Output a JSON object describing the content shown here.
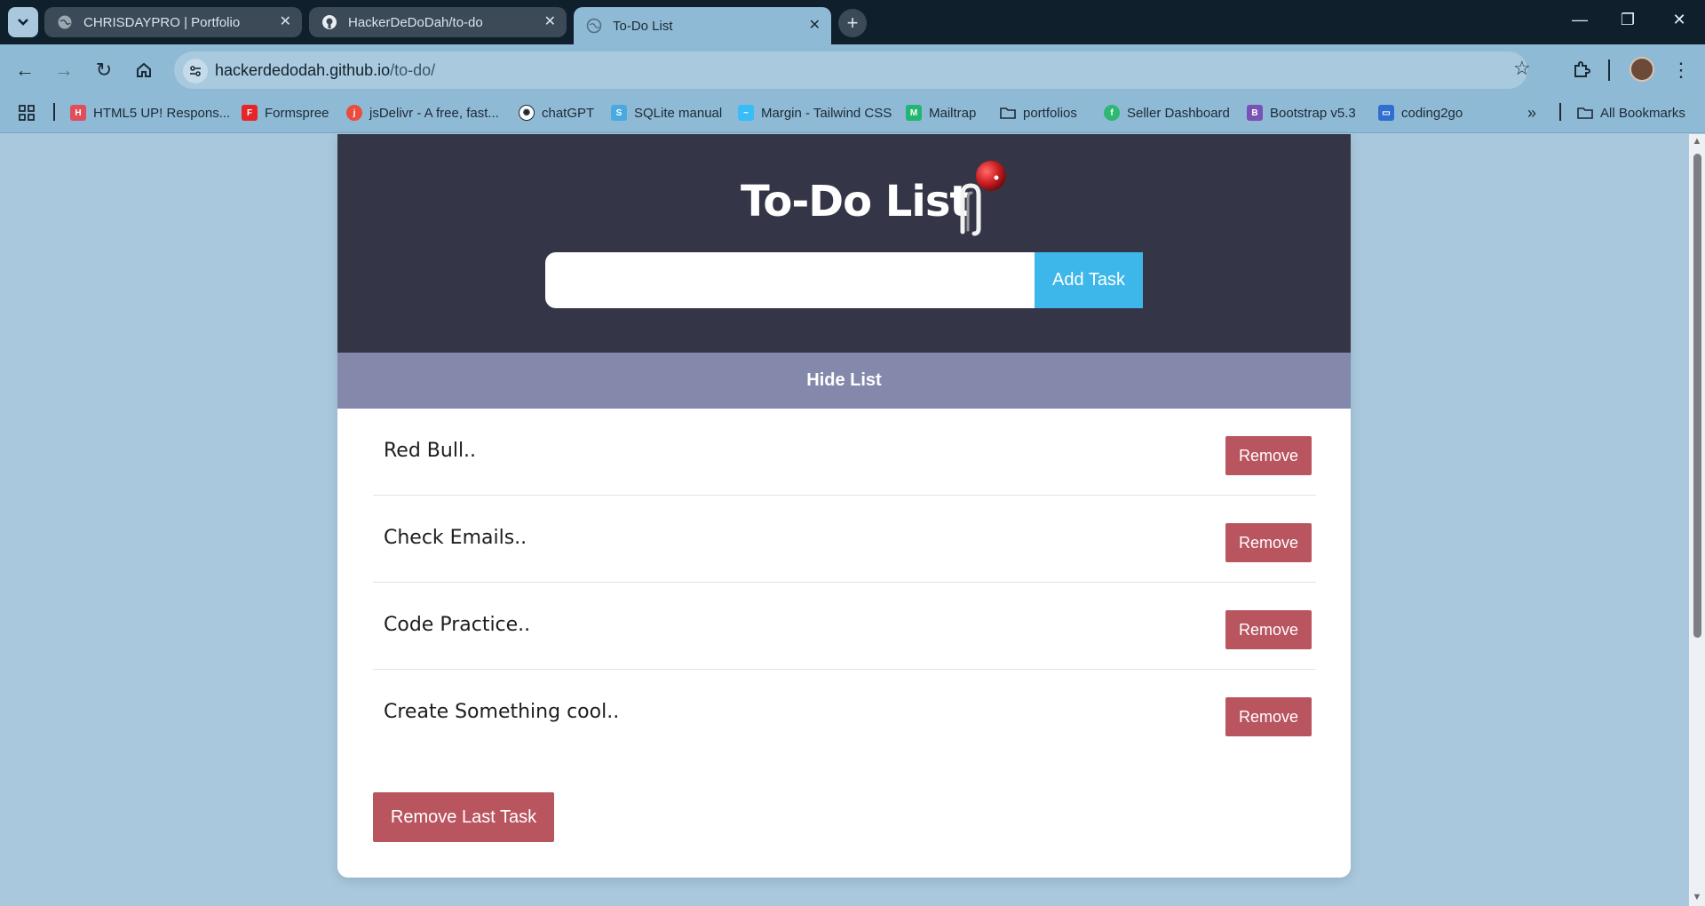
{
  "browser": {
    "tabs": [
      {
        "title": "CHRISDAYPRO | Portfolio",
        "icon": "globe-icon",
        "active": false
      },
      {
        "title": "HackerDeDoDah/to-do",
        "icon": "github-icon",
        "active": false
      },
      {
        "title": "To-Do List",
        "icon": "globe-icon",
        "active": true
      }
    ],
    "url": {
      "host": "hackerdedodah.github.io",
      "path": "/to-do/"
    },
    "bookmarks": [
      {
        "label": "HTML5 UP! Respons...",
        "icon": "html5up-icon",
        "color": "#e04e5c"
      },
      {
        "label": "Formspree",
        "icon": "formspree-icon",
        "color": "#e5252a"
      },
      {
        "label": "jsDelivr - A free, fast...",
        "icon": "jsdelivr-icon",
        "color": "#e84d3d"
      },
      {
        "label": "chatGPT",
        "icon": "openai-icon",
        "color": "#ffffff"
      },
      {
        "label": "SQLite manual",
        "icon": "sqlite-icon",
        "color": "#4aa9e0"
      },
      {
        "label": "Margin - Tailwind CSS",
        "icon": "tailwind-icon",
        "color": "#38bdf8"
      },
      {
        "label": "Mailtrap",
        "icon": "mailtrap-icon",
        "color": "#22b573"
      },
      {
        "label": "portfolios",
        "icon": "folder-icon",
        "color": "#1c2a35"
      },
      {
        "label": "Seller Dashboard",
        "icon": "seller-icon",
        "color": "#2eb872"
      },
      {
        "label": "Bootstrap v5.3",
        "icon": "bootstrap-icon",
        "color": "#7952b3"
      },
      {
        "label": "coding2go",
        "icon": "coding2go-icon",
        "color": "#2f6fd0"
      }
    ],
    "all_bookmarks": "All Bookmarks"
  },
  "app": {
    "title": "To-Do List",
    "input_value": "",
    "add_button": "Add Task",
    "hide_button": "Hide List",
    "tasks": [
      {
        "text": "Red Bull..",
        "remove": "Remove"
      },
      {
        "text": "Check Emails..",
        "remove": "Remove"
      },
      {
        "text": "Code Practice..",
        "remove": "Remove"
      },
      {
        "text": "Create Something cool..",
        "remove": "Remove"
      }
    ],
    "remove_last_button": "Remove Last Task"
  },
  "colors": {
    "page_bg": "#a9c8dd",
    "header_bg": "#343647",
    "hide_bar_bg": "#8489ab",
    "add_button": "#3db6ea",
    "remove_button": "#b9555f"
  }
}
